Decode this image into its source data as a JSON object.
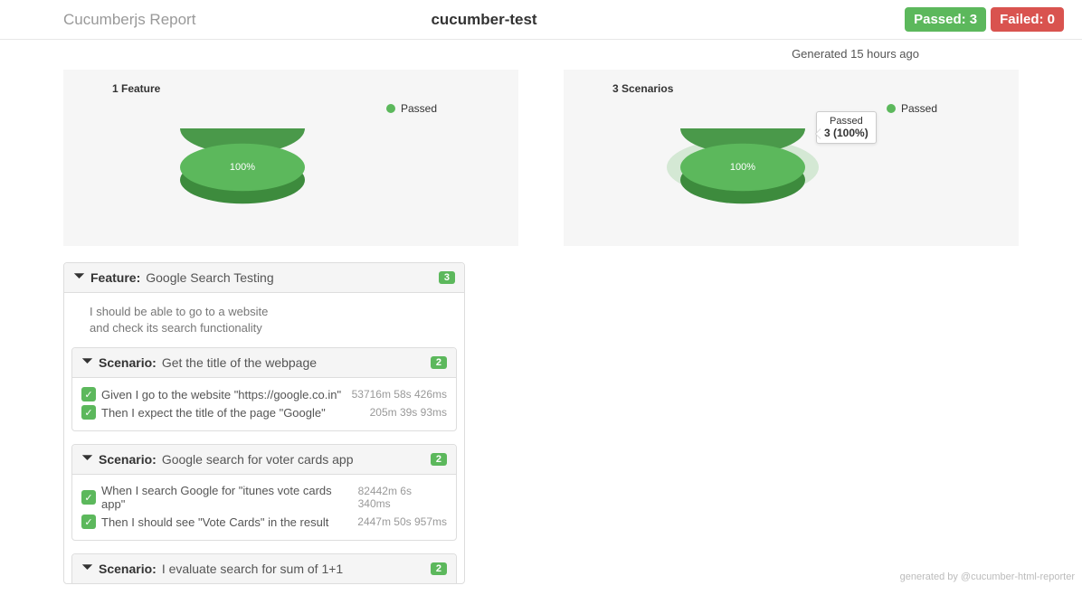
{
  "header": {
    "report_name": "Cucumberjs Report",
    "project_name": "cucumber-test",
    "passed_label": "Passed: 3",
    "failed_label": "Failed: 0"
  },
  "generated": "Generated 15 hours ago",
  "chart_data": [
    {
      "type": "pie",
      "title": "1 Feature",
      "categories": [
        "Passed"
      ],
      "values": [
        1
      ],
      "center_label": "100%",
      "legend": [
        "Passed"
      ],
      "colors": [
        "#5cb85c"
      ]
    },
    {
      "type": "pie",
      "title": "3 Scenarios",
      "categories": [
        "Passed"
      ],
      "values": [
        3
      ],
      "center_label": "100%",
      "legend": [
        "Passed"
      ],
      "colors": [
        "#5cb85c"
      ],
      "tooltip": {
        "line1": "Passed",
        "line2": "3 (100%)"
      }
    }
  ],
  "feature": {
    "label": "Feature:",
    "name": "Google Search Testing",
    "count": "3",
    "desc_line1": "I should be able to go to a website",
    "desc_line2": "and check its search functionality"
  },
  "scenarios": [
    {
      "label": "Scenario:",
      "name": "Get the title of the webpage",
      "count": "2",
      "steps": [
        {
          "text": "Given I go to the website \"https://google.co.in\"",
          "time": "53716m 58s 426ms"
        },
        {
          "text": "Then I expect the title of the page \"Google\"",
          "time": "205m 39s 93ms"
        }
      ]
    },
    {
      "label": "Scenario:",
      "name": "Google search for voter cards app",
      "count": "2",
      "steps": [
        {
          "text": "When I search Google for \"itunes vote cards app\"",
          "time": "82442m 6s 340ms"
        },
        {
          "text": "Then I should see \"Vote Cards\" in the result",
          "time": "2447m 50s 957ms"
        }
      ]
    },
    {
      "label": "Scenario:",
      "name": "I evaluate search for sum of 1+1",
      "count": "2",
      "steps": []
    }
  ],
  "footer": "generated by @cucumber-html-reporter"
}
